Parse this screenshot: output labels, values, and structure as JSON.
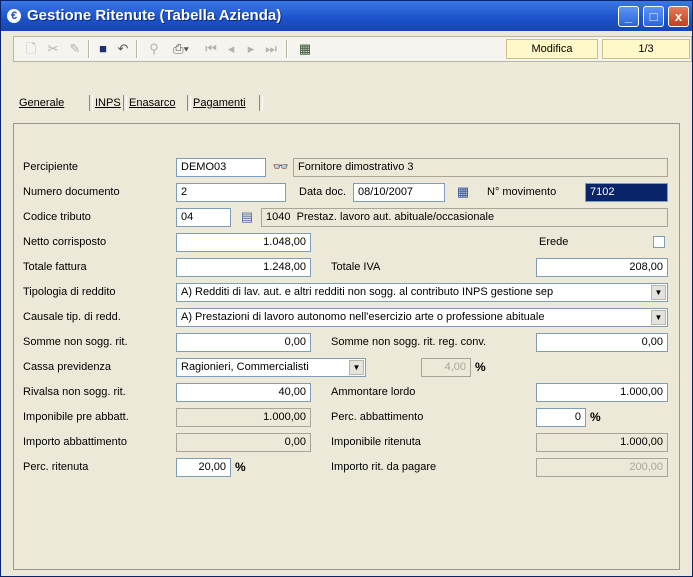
{
  "window": {
    "title": "Gestione Ritenute (Tabella Azienda)",
    "min": "_",
    "max": "□",
    "close": "x"
  },
  "toolbar": {
    "mode": "Modifica",
    "record": "1/3"
  },
  "tabs": [
    "Generale",
    "INPS",
    "Enasarco",
    "Pagamenti"
  ],
  "form": {
    "percipiente": {
      "label": "Percipiente",
      "code": "DEMO03",
      "name": "Fornitore dimostrativo 3"
    },
    "numero_documento": {
      "label": "Numero documento",
      "value": "2"
    },
    "data_doc": {
      "label": "Data doc.",
      "value": "08/10/2007"
    },
    "n_movimento": {
      "label": "N° movimento",
      "value": "7102"
    },
    "codice_tributo": {
      "label": "Codice tributo",
      "value1": "04",
      "value2": "1040",
      "desc": "Prestaz. lavoro aut. abituale/occasionale"
    },
    "netto_corrisposto": {
      "label": "Netto corrisposto",
      "value": "1.048,00"
    },
    "erede": {
      "label": "Erede"
    },
    "totale_fattura": {
      "label": "Totale fattura",
      "value": "1.248,00"
    },
    "totale_iva": {
      "label": "Totale IVA",
      "value": "208,00"
    },
    "tipologia": {
      "label": "Tipologia di reddito",
      "value": "A) Redditi di lav. aut. e altri redditi non sogg. al contributo INPS gestione sep"
    },
    "causale": {
      "label": "Causale tip. di redd.",
      "value": "A) Prestazioni di lavoro autonomo nell'esercizio arte o professione abituale"
    },
    "somme_non_sogg": {
      "label": "Somme non sogg. rit.",
      "value": "0,00"
    },
    "somme_non_sogg_reg": {
      "label": "Somme non sogg. rit. reg. conv.",
      "value": "0,00"
    },
    "cassa_previdenza": {
      "label": "Cassa previdenza",
      "value": "Ragionieri, Commercialisti",
      "pct": "4,00"
    },
    "rivalsa": {
      "label": "Rivalsa non sogg. rit.",
      "value": "40,00"
    },
    "ammontare_lordo": {
      "label": "Ammontare lordo",
      "value": "1.000,00"
    },
    "imponibile_pre": {
      "label": "Imponibile pre abbatt.",
      "value": "1.000,00"
    },
    "perc_abbattimento": {
      "label": "Perc. abbattimento",
      "value": "0"
    },
    "importo_abbattimento": {
      "label": "Importo abbattimento",
      "value": "0,00"
    },
    "imponibile_ritenuta": {
      "label": "Imponibile ritenuta",
      "value": "1.000,00"
    },
    "perc_ritenuta": {
      "label": "Perc. ritenuta",
      "value": "20,00"
    },
    "importo_da_pagare": {
      "label": "Importo rit. da pagare",
      "value": "200,00"
    },
    "pct_symbol": "%"
  }
}
